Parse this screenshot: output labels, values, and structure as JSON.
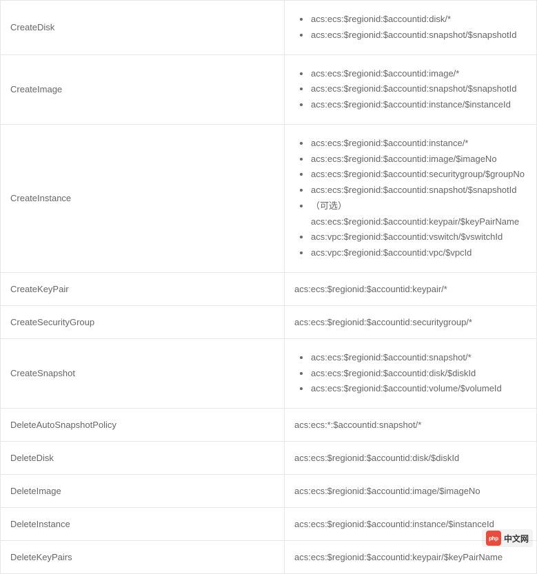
{
  "rows": [
    {
      "action": "CreateDisk",
      "type": "list",
      "resources": [
        "acs:ecs:$regionid:$accountid:disk/*",
        "acs:ecs:$regionid:$accountid:snapshot/$snapshotId"
      ]
    },
    {
      "action": "CreateImage",
      "type": "list",
      "resources": [
        "acs:ecs:$regionid:$accountid:image/*",
        "acs:ecs:$regionid:$accountid:snapshot/$snapshotId",
        "acs:ecs:$regionid:$accountid:instance/$instanceId"
      ]
    },
    {
      "action": "CreateInstance",
      "type": "list",
      "resources": [
        "acs:ecs:$regionid:$accountid:instance/*",
        "acs:ecs:$regionid:$accountid:image/$imageNo",
        "acs:ecs:$regionid:$accountid:securitygroup/$groupNo",
        "acs:ecs:$regionid:$accountid:snapshot/$snapshotId",
        "（可选）acs:ecs:$regionid:$accountid:keypair/$keyPairName",
        "acs:vpc:$regionid:$accountid:vswitch/$vswitchId",
        "acs:vpc:$regionid:$accountid:vpc/$vpcId"
      ]
    },
    {
      "action": "CreateKeyPair",
      "type": "single",
      "resources": "acs:ecs:$regionid:$accountid:keypair/*"
    },
    {
      "action": "CreateSecurityGroup",
      "type": "single",
      "resources": "acs:ecs:$regionid:$accountid:securitygroup/*"
    },
    {
      "action": "CreateSnapshot",
      "type": "list",
      "resources": [
        "acs:ecs:$regionid:$accountid:snapshot/*",
        "acs:ecs:$regionid:$accountid:disk/$diskId",
        "acs:ecs:$regionid:$accountid:volume/$volumeId"
      ]
    },
    {
      "action": "DeleteAutoSnapshotPolicy",
      "type": "single",
      "resources": "acs:ecs:*:$accountid:snapshot/*"
    },
    {
      "action": "DeleteDisk",
      "type": "single",
      "resources": "acs:ecs:$regionid:$accountid:disk/$diskId"
    },
    {
      "action": "DeleteImage",
      "type": "single",
      "resources": "acs:ecs:$regionid:$accountid:image/$imageNo"
    },
    {
      "action": "DeleteInstance",
      "type": "single",
      "resources": "acs:ecs:$regionid:$accountid:instance/$instanceId"
    },
    {
      "action": "DeleteKeyPairs",
      "type": "single",
      "resources": "acs:ecs:$regionid:$accountid:keypair/$keyPairName"
    }
  ],
  "watermark": {
    "logo_text": "php",
    "label": "中文网"
  }
}
